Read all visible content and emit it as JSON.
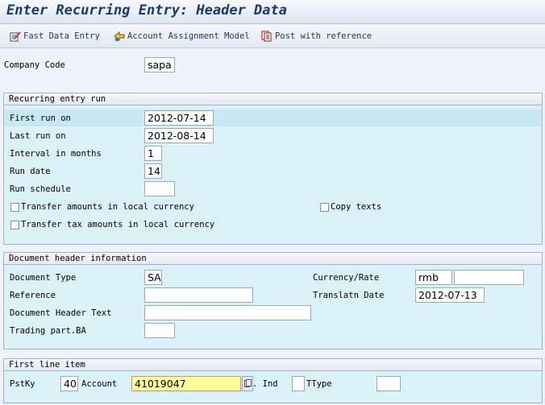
{
  "header": {
    "title": "Enter Recurring Entry: Header Data"
  },
  "toolbar": {
    "fast_data_entry": "Fast Data Entry",
    "account_assignment_model": "Account Assignment Model",
    "post_with_reference": "Post with reference"
  },
  "company": {
    "label": "Company Code",
    "value": "sapa"
  },
  "recurring": {
    "title": "Recurring entry run",
    "first_run_label": "First run on",
    "first_run_value": "2012-07-14",
    "last_run_label": "Last run on",
    "last_run_value": "2012-08-14",
    "interval_label": "Interval in months",
    "interval_value": "1",
    "run_date_label": "Run date",
    "run_date_value": "14",
    "run_schedule_label": "Run schedule",
    "run_schedule_value": "",
    "transfer_amounts_label": "Transfer amounts in local currency",
    "copy_texts_label": "Copy texts",
    "transfer_tax_label": "Transfer tax amounts in local currency"
  },
  "doc_header": {
    "title": "Document header information",
    "doc_type_label": "Document Type",
    "doc_type_value": "SA",
    "currency_label": "Currency/Rate",
    "currency_value": "rmb",
    "rate_value": "",
    "reference_label": "Reference",
    "reference_value": "",
    "translatn_date_label": "Translatn Date",
    "translatn_date_value": "2012-07-13",
    "header_text_label": "Document Header Text",
    "header_text_value": "",
    "trading_part_label": "Trading part.BA",
    "trading_part_value": ""
  },
  "first_line": {
    "title": "First line item",
    "pstky_label": "PstKy",
    "pstky_value": "40",
    "account_label": "Account",
    "account_value": "41019047",
    "ind_label": ". Ind",
    "ind_value": "",
    "ttype_label": "TType",
    "ttype_value": ""
  },
  "icons": [
    "fast-data-entry-icon",
    "account-assignment-model-icon",
    "post-with-reference-icon",
    "matchcode-icon"
  ]
}
